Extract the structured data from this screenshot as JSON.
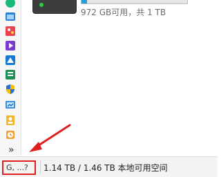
{
  "drive": {
    "free_space_text": "972 GB可用，共 1 TB",
    "used_fraction": 0.05
  },
  "status_bar": {
    "selection_label": "G, ...?",
    "summary_text": "1.14 TB / 1.46 TB 本地可用空间"
  },
  "sidebar": {
    "icons": [
      "green-circle-icon",
      "photos-app-icon",
      "color-palette-app-icon",
      "video-app-icon",
      "store-app-icon",
      "spreadsheet-app-icon",
      "shield-icon",
      "control-panel-icon",
      "contact-icon",
      "alarm-clock-icon"
    ],
    "overflow_label": "»"
  },
  "annotation": {
    "highlight_color": "#e02020"
  }
}
